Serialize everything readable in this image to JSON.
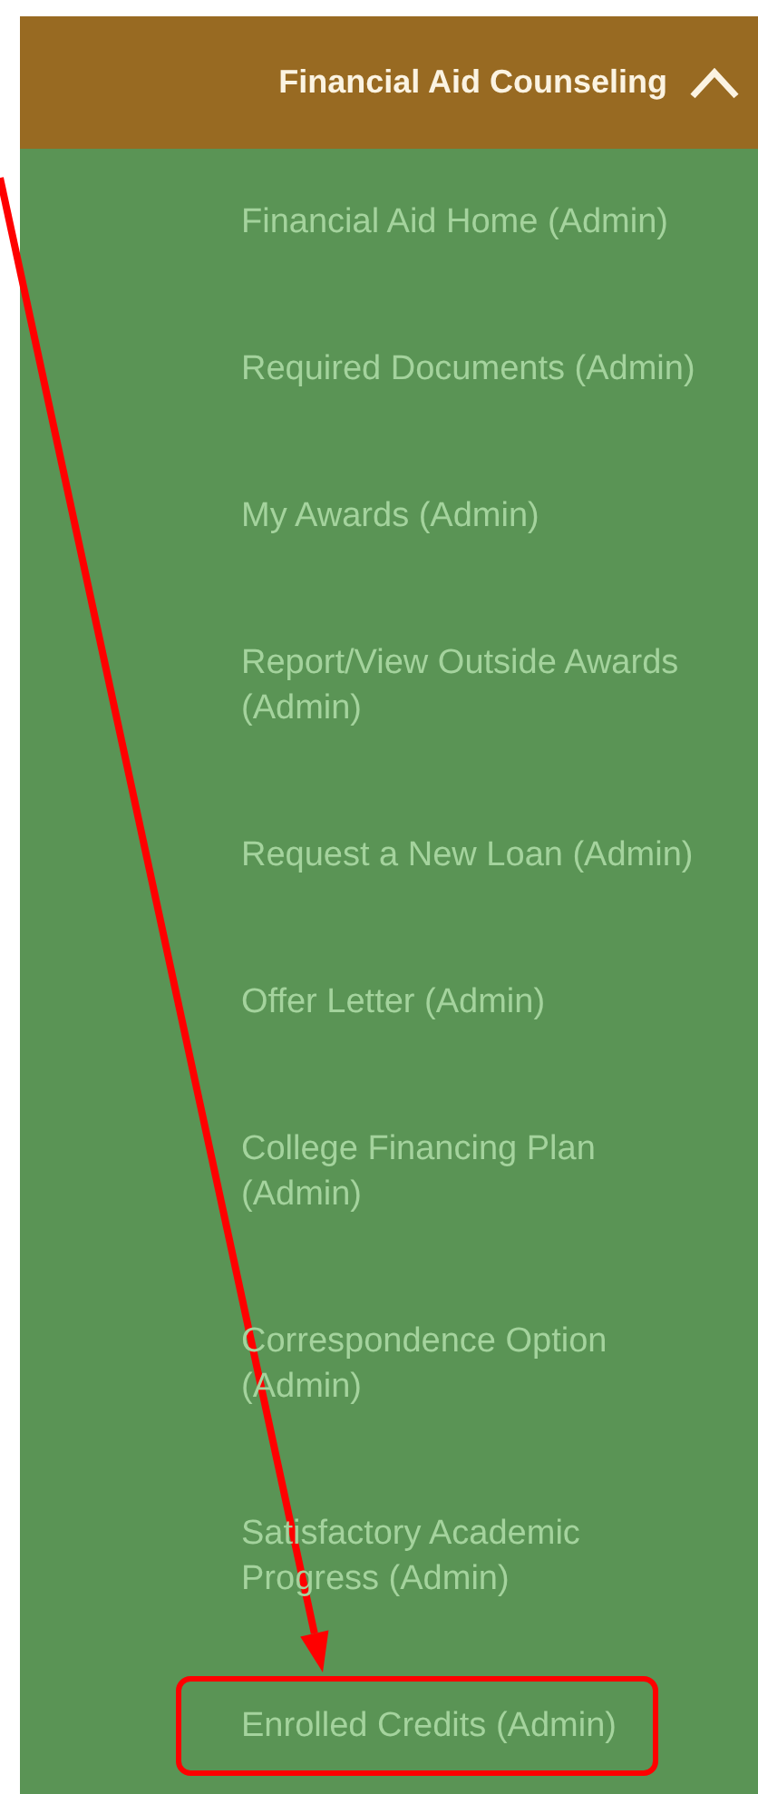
{
  "header": {
    "title": "Financial Aid Counseling",
    "expanded": true
  },
  "menu_items": [
    {
      "lines": [
        "Financial Aid Home (Admin)"
      ],
      "highlighted": false
    },
    {
      "lines": [
        "Required Documents (Admin)"
      ],
      "highlighted": false
    },
    {
      "lines": [
        "My Awards (Admin)"
      ],
      "highlighted": false
    },
    {
      "lines": [
        "Report/View Outside Awards",
        "(Admin)"
      ],
      "highlighted": false
    },
    {
      "lines": [
        "Request a New Loan (Admin)"
      ],
      "highlighted": false
    },
    {
      "lines": [
        "Offer Letter (Admin)"
      ],
      "highlighted": false
    },
    {
      "lines": [
        "College Financing Plan",
        "(Admin)"
      ],
      "highlighted": false
    },
    {
      "lines": [
        "Correspondence Option",
        "(Admin)"
      ],
      "highlighted": false
    },
    {
      "lines": [
        "Satisfactory Academic",
        "Progress (Admin)"
      ],
      "highlighted": false
    },
    {
      "lines": [
        "Enrolled Credits (Admin)"
      ],
      "highlighted": true
    }
  ]
}
